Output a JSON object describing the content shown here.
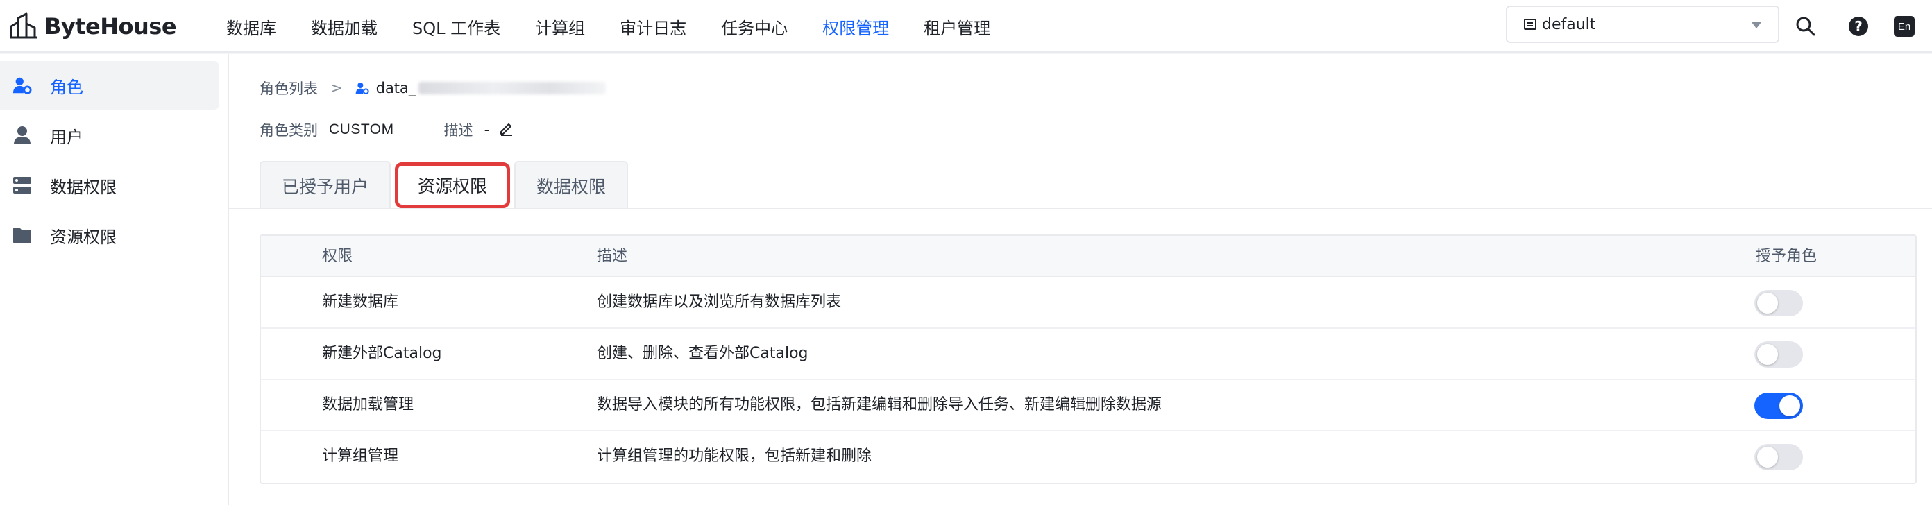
{
  "app": {
    "name": "ByteHouse"
  },
  "nav": {
    "items": [
      {
        "label": "数据库",
        "active": false
      },
      {
        "label": "数据加载",
        "active": false
      },
      {
        "label": "SQL 工作表",
        "active": false
      },
      {
        "label": "计算组",
        "active": false
      },
      {
        "label": "审计日志",
        "active": false
      },
      {
        "label": "任务中心",
        "active": false
      },
      {
        "label": "权限管理",
        "active": true
      },
      {
        "label": "租户管理",
        "active": false
      }
    ],
    "workspace": "default",
    "help_glyph": "?",
    "lang_label": "En",
    "accent": "#1664ff"
  },
  "sidebar": {
    "items": [
      {
        "label": "角色",
        "icon": "user-cog-icon",
        "active": true
      },
      {
        "label": "用户",
        "icon": "user-icon",
        "active": false
      },
      {
        "label": "数据权限",
        "icon": "server-icon",
        "active": false
      },
      {
        "label": "资源权限",
        "icon": "folder-icon",
        "active": false
      }
    ]
  },
  "breadcrumb": {
    "root": "角色列表",
    "sep": ">",
    "current": "data_"
  },
  "role": {
    "type_label": "角色类别",
    "type_value": "CUSTOM",
    "desc_label": "描述",
    "desc_value": "-"
  },
  "tabs": [
    {
      "label": "已授予用户",
      "active": false
    },
    {
      "label": "资源权限",
      "active": true
    },
    {
      "label": "数据权限",
      "active": false
    }
  ],
  "table": {
    "headers": {
      "perm": "权限",
      "desc": "描述",
      "grant": "授予角色"
    },
    "rows": [
      {
        "perm": "新建数据库",
        "desc": "创建数据库以及浏览所有数据库列表",
        "granted": false
      },
      {
        "perm": "新建外部Catalog",
        "desc": "创建、删除、查看外部Catalog",
        "granted": false
      },
      {
        "perm": "数据加载管理",
        "desc": "数据导入模块的所有功能权限，包括新建编辑和删除导入任务、新建编辑删除数据源",
        "granted": true
      },
      {
        "perm": "计算组管理",
        "desc": "计算组管理的功能权限，包括新建和删除",
        "granted": false
      }
    ]
  }
}
